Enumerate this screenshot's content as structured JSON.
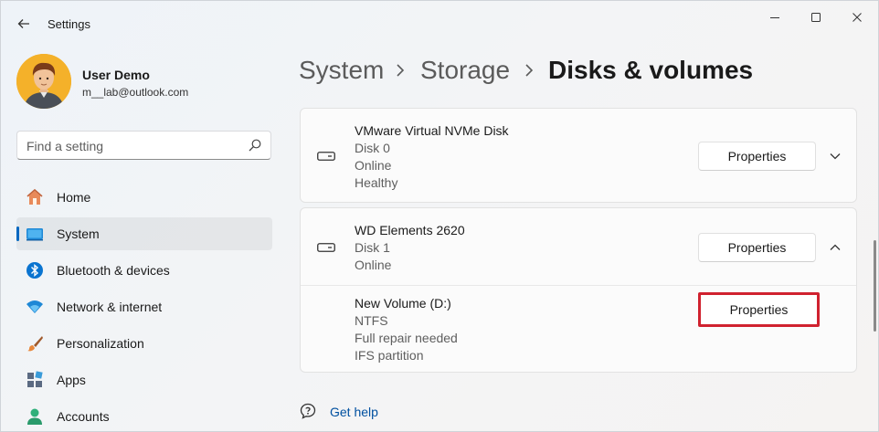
{
  "window": {
    "title": "Settings",
    "controls": [
      "minimize",
      "maximize",
      "close"
    ]
  },
  "user": {
    "name": "User Demo",
    "email": "m__lab@outlook.com"
  },
  "search": {
    "placeholder": "Find a setting"
  },
  "sidebar": {
    "items": [
      {
        "label": "Home",
        "icon": "home-icon",
        "selected": false
      },
      {
        "label": "System",
        "icon": "system-icon",
        "selected": true
      },
      {
        "label": "Bluetooth & devices",
        "icon": "bluetooth-icon",
        "selected": false
      },
      {
        "label": "Network & internet",
        "icon": "network-icon",
        "selected": false
      },
      {
        "label": "Personalization",
        "icon": "brush-icon",
        "selected": false
      },
      {
        "label": "Apps",
        "icon": "apps-icon",
        "selected": false
      },
      {
        "label": "Accounts",
        "icon": "accounts-icon",
        "selected": false
      }
    ]
  },
  "breadcrumb": {
    "items": [
      "System",
      "Storage",
      "Disks & volumes"
    ]
  },
  "disks": [
    {
      "name": "VMware Virtual NVMe Disk",
      "number": "Disk 0",
      "status": "Online",
      "health": "Healthy",
      "button": "Properties",
      "expanded": false
    },
    {
      "name": "WD Elements 2620",
      "number": "Disk 1",
      "status": "Online",
      "button": "Properties",
      "expanded": true,
      "volumes": [
        {
          "name": "New Volume (D:)",
          "filesystem": "NTFS",
          "state": "Full repair needed",
          "type": "IFS partition",
          "button": "Properties",
          "highlighted": true
        }
      ]
    }
  ],
  "help": {
    "label": "Get help"
  },
  "colors": {
    "accent": "#0067c0",
    "highlight_border": "#d0222f",
    "link": "#0050a0"
  }
}
